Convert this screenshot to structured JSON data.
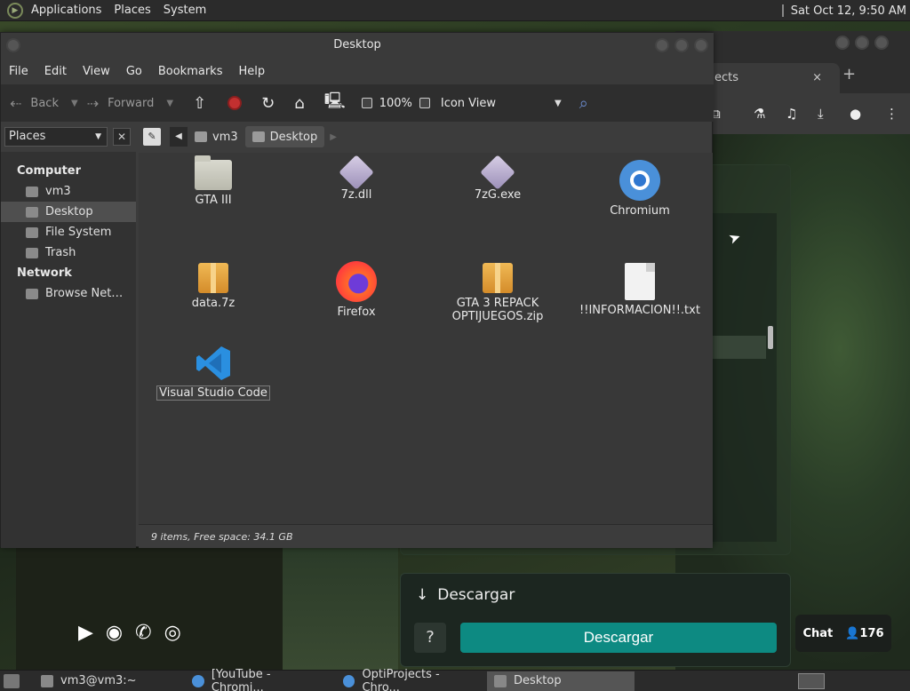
{
  "top_panel": {
    "menus": [
      "Applications",
      "Places",
      "System"
    ],
    "clock": "Sat Oct 12,  9:50 AM"
  },
  "chrome": {
    "tab_title": "ects",
    "tab_close": "×",
    "new_tab": "+"
  },
  "web": {
    "download_header": "Descargar",
    "help_button": "?",
    "download_button": "Descargar",
    "chat_label": "Chat",
    "chat_count": "176"
  },
  "file_manager": {
    "title": "Desktop",
    "menubar": [
      "File",
      "Edit",
      "View",
      "Go",
      "Bookmarks",
      "Help"
    ],
    "toolbar": {
      "back": "Back",
      "forward": "Forward",
      "zoom": "100%",
      "view_mode": "Icon View"
    },
    "side_pane_title": "Places",
    "sidebar": {
      "computer_label": "Computer",
      "computer_items": [
        {
          "label": "vm3"
        },
        {
          "label": "Desktop"
        },
        {
          "label": "File System"
        },
        {
          "label": "Trash"
        }
      ],
      "network_label": "Network",
      "network_items": [
        {
          "label": "Browse Net…"
        }
      ]
    },
    "path": {
      "segments": [
        "vm3",
        "Desktop"
      ]
    },
    "files": [
      {
        "name": "GTA III",
        "icon": "folder-icon"
      },
      {
        "name": "7z.dll",
        "icon": "binary-icon"
      },
      {
        "name": "7zG.exe",
        "icon": "binary-icon"
      },
      {
        "name": "Chromium",
        "icon": "chromium-icon"
      },
      {
        "name": "data.7z",
        "icon": "archive-icon"
      },
      {
        "name": "Firefox",
        "icon": "firefox-icon"
      },
      {
        "name": "GTA 3 REPACK OPTIJUEGOS.zip",
        "icon": "archive-icon"
      },
      {
        "name": "!!INFORMACION!!.txt",
        "icon": "text-file-icon"
      },
      {
        "name": "Visual Studio Code",
        "icon": "vscode-icon"
      }
    ],
    "status": "9 items, Free space: 34.1 GB"
  },
  "taskbar": {
    "tasks": [
      {
        "label": "vm3@vm3:~"
      },
      {
        "label": "[YouTube - Chromi..."
      },
      {
        "label": "OptiProjects - Chro..."
      },
      {
        "label": "Desktop"
      }
    ]
  }
}
